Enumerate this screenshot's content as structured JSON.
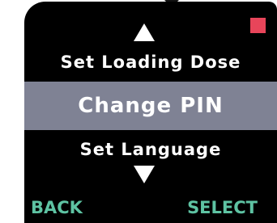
{
  "menu": {
    "previous_item": "Set Loading Dose",
    "selected_item": "Change PIN",
    "next_item": "Set Language",
    "up_icon": "triangle-up-icon",
    "down_icon": "triangle-down-icon",
    "highlight_color": "#7f8294"
  },
  "status": {
    "indicator_color": "#e8455a"
  },
  "softkeys": {
    "back_label": "BACK",
    "select_label": "SELECT",
    "label_color": "#5ec3a3"
  }
}
